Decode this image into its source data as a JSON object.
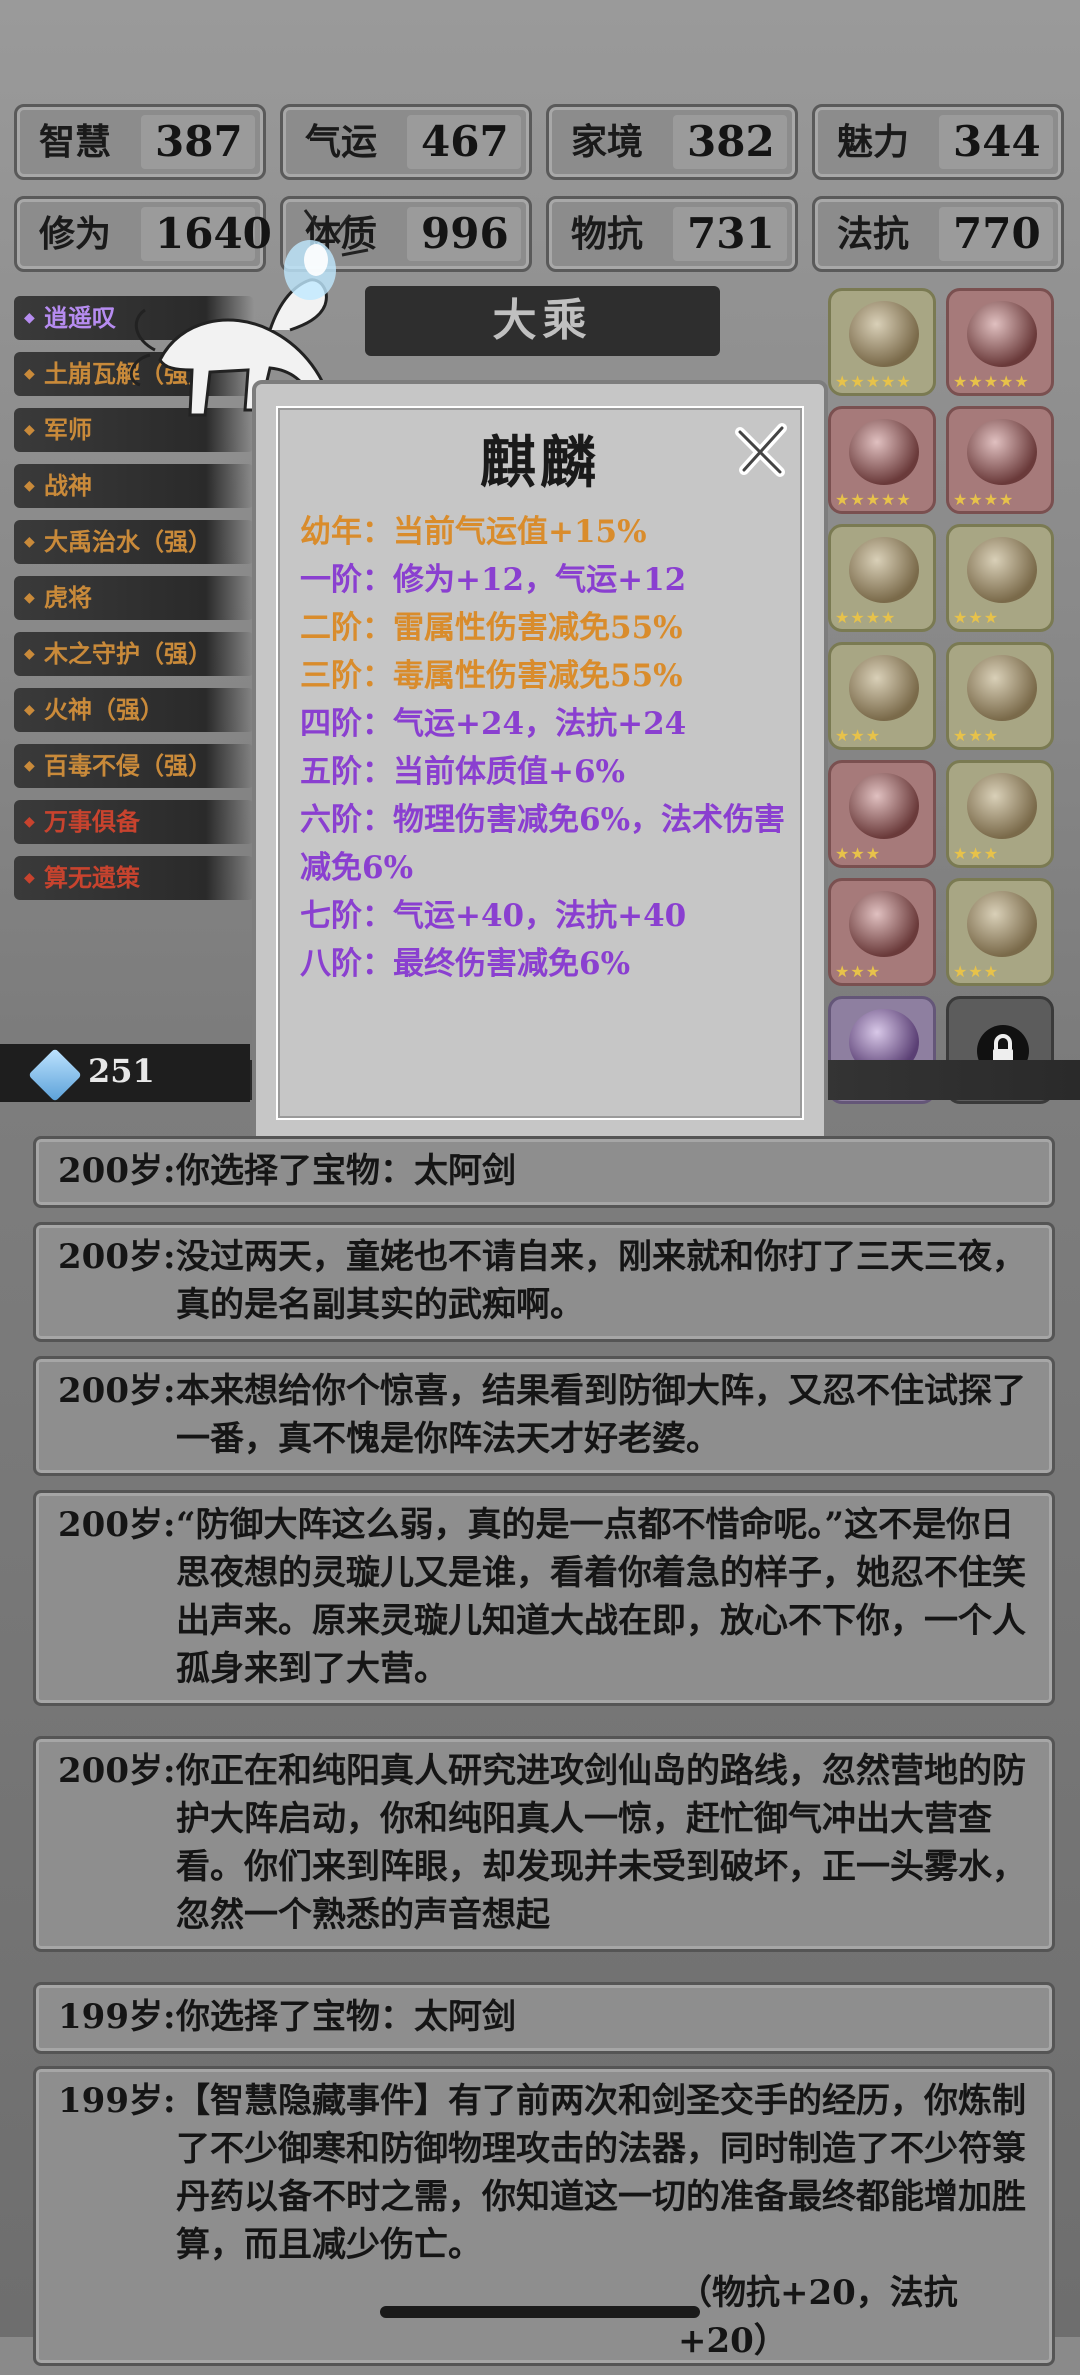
{
  "stats": [
    {
      "label": "智慧",
      "value": "387"
    },
    {
      "label": "气运",
      "value": "467"
    },
    {
      "label": "家境",
      "value": "382"
    },
    {
      "label": "魅力",
      "value": "344"
    },
    {
      "label": "修为",
      "value": "1640"
    },
    {
      "label": "体质",
      "value": "996"
    },
    {
      "label": "物抗",
      "value": "731"
    },
    {
      "label": "法抗",
      "value": "770"
    }
  ],
  "realm": "大乘",
  "tags": [
    {
      "label": "逍遥叹",
      "color": "purple"
    },
    {
      "label": "土崩瓦解（强）",
      "color": "orange"
    },
    {
      "label": "军师",
      "color": "orange"
    },
    {
      "label": "战神",
      "color": "orange"
    },
    {
      "label": "大禹治水（强）",
      "color": "orange"
    },
    {
      "label": "虎将",
      "color": "orange"
    },
    {
      "label": "木之守护（强）",
      "color": "orange"
    },
    {
      "label": "火神（强）",
      "color": "orange"
    },
    {
      "label": "百毒不侵（强）",
      "color": "orange"
    },
    {
      "label": "万事俱备",
      "color": "red"
    },
    {
      "label": "算无遗策",
      "color": "red"
    }
  ],
  "currency": {
    "value": "251",
    "icon": "crystal-icon"
  },
  "items": [
    {
      "name": "scroll-key",
      "rarity": "gold",
      "stars": 5
    },
    {
      "name": "sword",
      "rarity": "red",
      "stars": 5
    },
    {
      "name": "pouch",
      "rarity": "red",
      "stars": 5
    },
    {
      "name": "spear",
      "rarity": "red",
      "stars": 4
    },
    {
      "name": "gauntlet",
      "rarity": "gold",
      "stars": 4
    },
    {
      "name": "scroll",
      "rarity": "gold",
      "stars": 3
    },
    {
      "name": "cauldron",
      "rarity": "gold",
      "stars": 3
    },
    {
      "name": "crystal",
      "rarity": "gold",
      "stars": 3
    },
    {
      "name": "axe",
      "rarity": "red",
      "stars": 3
    },
    {
      "name": "fan",
      "rarity": "gold",
      "stars": 3
    },
    {
      "name": "mirror",
      "rarity": "red",
      "stars": 3
    },
    {
      "name": "teapot",
      "rarity": "gold",
      "stars": 3
    },
    {
      "name": "blade",
      "rarity": "purple",
      "stars": 3
    },
    {
      "name": "locked",
      "rarity": "dark",
      "stars": 0
    }
  ],
  "modal": {
    "title": "麒麟",
    "lines": [
      {
        "text": "幼年：当前气运值+15%",
        "color": "orange"
      },
      {
        "text": "一阶：修为+12，气运+12",
        "color": "purple"
      },
      {
        "text": "二阶：雷属性伤害减免55%",
        "color": "orange"
      },
      {
        "text": "三阶：毒属性伤害减免55%",
        "color": "orange"
      },
      {
        "text": "四阶：气运+24，法抗+24",
        "color": "purple"
      },
      {
        "text": "五阶：当前体质值+6%",
        "color": "purple"
      },
      {
        "text": "六阶：物理伤害减免6%，法术伤害减免6%",
        "color": "purple"
      },
      {
        "text": "七阶：气运+40，法抗+40",
        "color": "purple"
      },
      {
        "text": "八阶：最终伤害减免6%",
        "color": "purple"
      }
    ]
  },
  "log": [
    {
      "age": "200岁:",
      "text": "你选择了宝物：太阿剑"
    },
    {
      "age": "200岁:",
      "text": "没过两天，童姥也不请自来，刚来就和你打了三天三夜，真的是名副其实的武痴啊。"
    },
    {
      "age": "200岁:",
      "text": "本来想给你个惊喜，结果看到防御大阵，又忍不住试探了一番，真不愧是你阵法天才好老婆。"
    },
    {
      "age": "200岁:",
      "text": "“防御大阵这么弱，真的是一点都不惜命呢。”这不是你日思夜想的灵璇儿又是谁，看着你着急的样子，她忍不住笑出声来。原来灵璇儿知道大战在即，放心不下你，一个人孤身来到了大营。"
    },
    {
      "age": "200岁:",
      "text": "你正在和纯阳真人研究进攻剑仙岛的路线，忽然营地的防护大阵启动，你和纯阳真人一惊，赶忙御气冲出大营查看。你们来到阵眼，却发现并未受到破坏，正一头雾水，忽然一个熟悉的声音想起"
    },
    {
      "age": "199岁:",
      "text": "你选择了宝物：太阿剑"
    },
    {
      "age": "199岁:",
      "text": "【智慧隐藏事件】有了前两次和剑圣交手的经历，你炼制了不少御寒和防御物理攻击的法器，同时制造了不少符箓丹药以备不时之需，你知道这一切的准备最终都能增加胜算，而且减少伤亡。"
    },
    {
      "age": "",
      "text": "（物抗+20，法抗+20）"
    }
  ]
}
